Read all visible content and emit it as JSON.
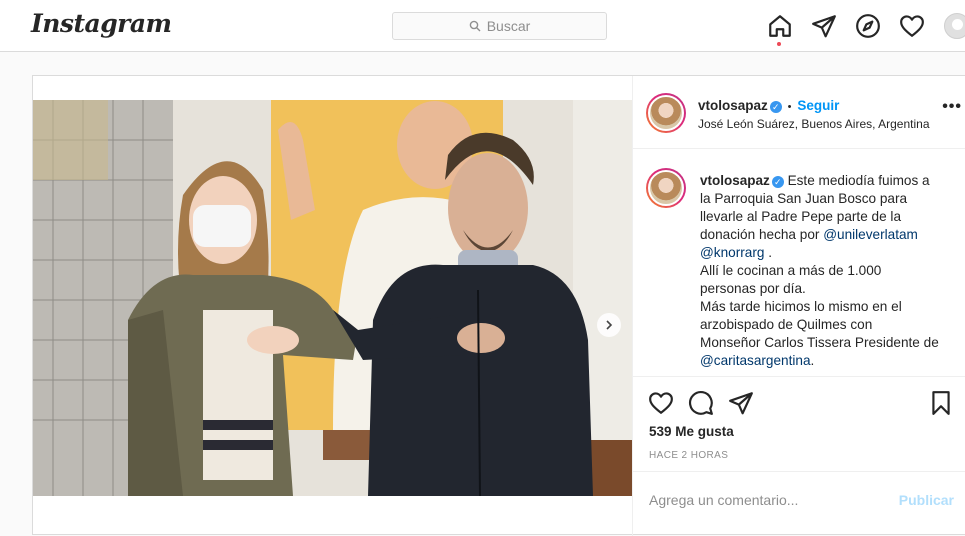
{
  "nav": {
    "logo": "Instagram",
    "search_placeholder": "Buscar",
    "icons": [
      "home-icon",
      "direct-icon",
      "explore-icon",
      "activity-heart-icon",
      "profile-avatar"
    ]
  },
  "post": {
    "username": "vtolosapaz",
    "separator": "•",
    "follow_label": "Seguir",
    "location": "José León Suárez, Buenos Aires, Argentina",
    "more_label": "•••",
    "caption_lines": [
      {
        "text": "Este mediodía fuimos a"
      },
      {
        "text": "la Parroquia San Juan Bosco para"
      },
      {
        "text": "llevarle al Padre Pepe parte de la"
      },
      {
        "text": "donación hecha por "
      },
      {
        "text": "@knorrarg"
      },
      {
        "text": "Allí le cocinan a más de 1.000"
      },
      {
        "text": "personas por día."
      },
      {
        "text": "Más tarde hicimos lo mismo en el"
      },
      {
        "text": "arzobispado de Quilmes con"
      },
      {
        "text": "Monseñor Carlos Tissera Presidente de"
      },
      {
        "text": "@caritasargentina"
      }
    ],
    "mention_unilever": "@unileverlatam",
    "mention_knorr_suffix": " .",
    "mention_caritas_suffix": ".",
    "likes": "539 Me gusta",
    "time": "HACE 2 HORAS",
    "comment_placeholder": "Agrega un comentario...",
    "publish_label": "Publicar",
    "carousel": {
      "count": 8,
      "active_index": 0
    }
  },
  "colors": {
    "link": "#0095f6",
    "mention": "#00376b",
    "publish_disabled": "#b2dffc",
    "notification_dot": "#ed4956"
  }
}
